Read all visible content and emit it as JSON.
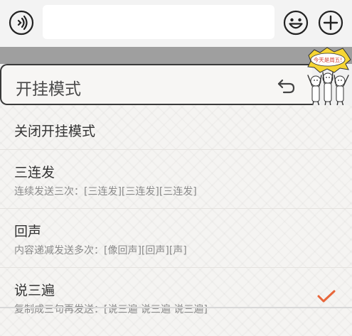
{
  "input_bar": {
    "voice_icon": "voice-input-icon",
    "emoji_icon": "smiley-face-icon",
    "plus_icon": "plus-circle-icon",
    "message_value": ""
  },
  "mode_panel": {
    "title": "开挂模式",
    "back_icon": "undo-arrow-icon",
    "sticker_text": "今天是周五!"
  },
  "modes": [
    {
      "title": "关闭开挂模式",
      "desc": ""
    },
    {
      "title": "三连发",
      "desc": "连续发送三次：[三连发][三连发][三连发]"
    },
    {
      "title": "回声",
      "desc": "内容递减发送多次：[像回声][回声][声]"
    },
    {
      "title": "说三遍",
      "desc": "复制成三句再发送：[说三遍 说三遍 说三遍]",
      "selected": true
    }
  ],
  "colors": {
    "accent": "#e8663a",
    "header_strip": "#9f9f9f"
  }
}
